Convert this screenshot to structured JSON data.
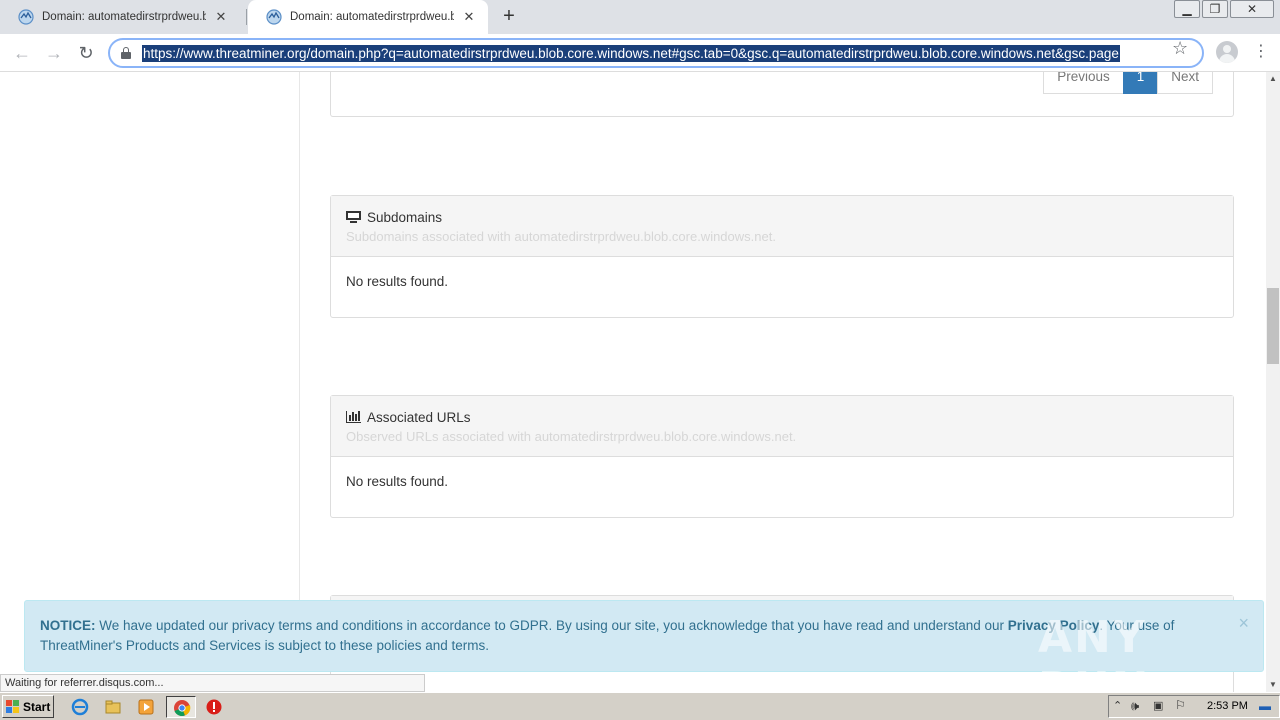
{
  "browser": {
    "tabs": [
      {
        "title": "Domain: automatedirstrprdweu.blob",
        "active": false
      },
      {
        "title": "Domain: automatedirstrprdweu.blob",
        "active": true
      }
    ],
    "new_tab": "+",
    "url": "https://www.threatminer.org/domain.php?q=automatedirstrprdweu.blob.core.windows.net#gsc.tab=0&gsc.q=automatedirstrprdweu.blob.core.windows.net&gsc.page",
    "status": "Waiting for referrer.disqus.com..."
  },
  "pagination": {
    "previous": "Previous",
    "current": "1",
    "next": "Next"
  },
  "sections": {
    "subdomains": {
      "title": "Subdomains",
      "subtitle": "Subdomains associated with automatedirstrprdweu.blob.core.windows.net.",
      "body": "No results found.",
      "icon": "monitor-icon"
    },
    "urls": {
      "title": "Associated URLs",
      "subtitle": "Observed URLs associated with automatedirstrprdweu.blob.core.windows.net.",
      "body": "No results found.",
      "icon": "bar-chart-icon"
    }
  },
  "notice": {
    "label": "NOTICE:",
    "text_before": " We have updated our privacy terms and conditions in accordance to GDPR. By using our site, you acknowledge that you have read and understand our ",
    "link": "Privacy Policy",
    "text_after": ". Your use of ThreatMiner's Products and Services is subject to these policies and terms.",
    "close": "×"
  },
  "watermark": "ANY RUN",
  "taskbar": {
    "start": "Start",
    "clock": "2:53 PM"
  },
  "colors": {
    "accent": "#337ab7",
    "notice_bg": "#d2e9f3",
    "notice_text": "#31708f",
    "url_highlight": "#1a3f7a"
  }
}
